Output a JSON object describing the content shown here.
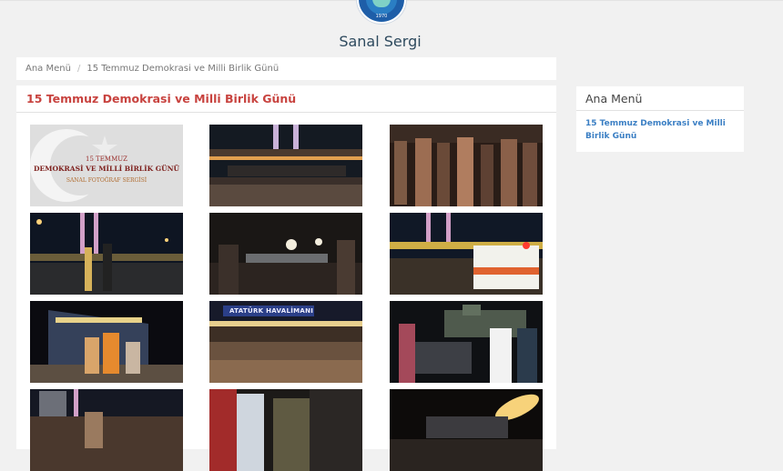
{
  "site": {
    "title": "Sanal Sergi",
    "logo_year": "1970"
  },
  "breadcrumb": {
    "home": "Ana Menü",
    "current": "15 Temmuz Demokrasi ve Milli Birlik Günü"
  },
  "gallery": {
    "title": "15 Temmuz Demokrasi ve Milli Birlik Günü",
    "poster": {
      "line1": "15 TEMMUZ",
      "line2": "DEMOKRASİ VE MİLLİ BİRLİK GÜNÜ",
      "line3": "SANAL FOTOĞRAF SERGİSİ"
    },
    "photo_signs": {
      "airport": "ATATÜRK HAVALİMANI"
    }
  },
  "sidebar": {
    "title": "Ana Menü",
    "items": [
      {
        "label": "15 Temmuz Demokrasi ve Milli Birlik Günü"
      }
    ]
  },
  "colors": {
    "accent": "#c8433f",
    "link": "#3b7fc4",
    "title": "#2e4a5e"
  }
}
